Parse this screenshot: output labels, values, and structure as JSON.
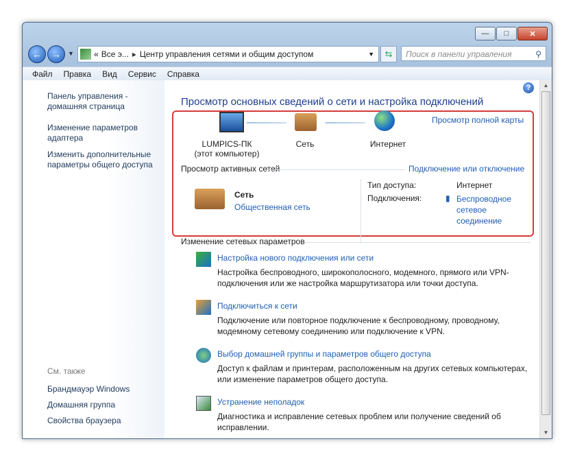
{
  "window": {
    "minimize": "—",
    "maximize": "□",
    "close": "✕"
  },
  "nav": {
    "back_icon": "arrow-left",
    "forward_icon": "arrow-right",
    "breadcrumb_root": "Все э...",
    "breadcrumb_current": "Центр управления сетями и общим доступом",
    "search_placeholder": "Поиск в панели управления"
  },
  "menu": [
    "Файл",
    "Правка",
    "Вид",
    "Сервис",
    "Справка"
  ],
  "sidebar": {
    "links": [
      "Панель управления - домашняя страница",
      "Изменение параметров адаптера",
      "Изменить дополнительные параметры общего доступа"
    ],
    "see_also": "См. также",
    "also_links": [
      "Брандмауэр Windows",
      "Домашняя группа",
      "Свойства браузера"
    ]
  },
  "main": {
    "title": "Просмотр основных сведений о сети и настройка подключений",
    "full_map": "Просмотр полной карты",
    "map": {
      "computer": "LUMPICS-ПК",
      "computer_sub": "(этот компьютер)",
      "network": "Сеть",
      "internet": "Интернет"
    },
    "active_header": "Просмотр активных сетей",
    "connect_link": "Подключение или отключение",
    "active": {
      "name": "Сеть",
      "type": "Общественная сеть",
      "access_label": "Тип доступа:",
      "access_value": "Интернет",
      "conn_label": "Подключения:",
      "conn_value": "Беспроводное сетевое соединение"
    },
    "change_header": "Изменение сетевых параметров",
    "tasks": [
      {
        "title": "Настройка нового подключения или сети",
        "desc": "Настройка беспроводного, широкополосного, модемного, прямого или VPN-подключения или же настройка маршрутизатора или точки доступа."
      },
      {
        "title": "Подключиться к сети",
        "desc": "Подключение или повторное подключение к беспроводному, проводному, модемному сетевому соединению или подключение к VPN."
      },
      {
        "title": "Выбор домашней группы и параметров общего доступа",
        "desc": "Доступ к файлам и принтерам, расположенным на других сетевых компьютерах, или изменение параметров общего доступа."
      },
      {
        "title": "Устранение неполадок",
        "desc": "Диагностика и исправление сетевых проблем или получение сведений об исправлении."
      }
    ]
  },
  "colors": {
    "link": "#1e5eb5",
    "title": "#1e3d8e",
    "highlight": "#d63a3a"
  }
}
